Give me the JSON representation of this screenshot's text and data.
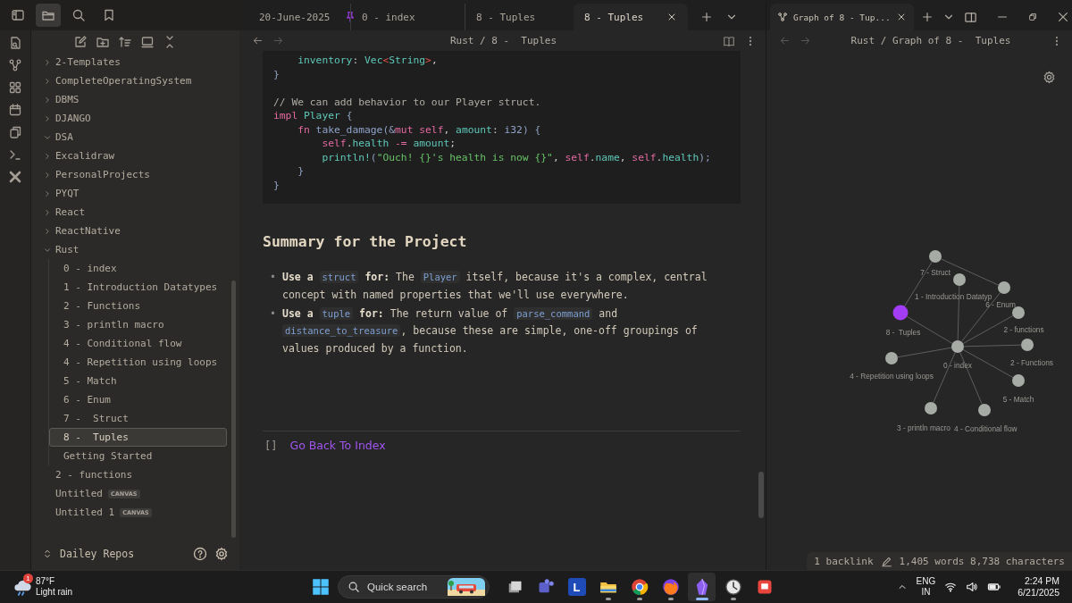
{
  "sidebar": {
    "tree": [
      {
        "label": "2-Templates",
        "kind": "folder",
        "expanded": false,
        "selected": false
      },
      {
        "label": "CompleteOperatingSystem",
        "kind": "folder",
        "expanded": false,
        "selected": false
      },
      {
        "label": "DBMS",
        "kind": "folder",
        "expanded": false,
        "selected": false
      },
      {
        "label": "DJANGO",
        "kind": "folder",
        "expanded": false,
        "selected": false
      },
      {
        "label": "DSA",
        "kind": "folder",
        "expanded": true,
        "selected": false
      },
      {
        "label": "Excalidraw",
        "kind": "folder",
        "expanded": false,
        "selected": false
      },
      {
        "label": "PersonalProjects",
        "kind": "folder",
        "expanded": false,
        "selected": false
      },
      {
        "label": "PYQT",
        "kind": "folder",
        "expanded": false,
        "selected": false
      },
      {
        "label": "React",
        "kind": "folder",
        "expanded": false,
        "selected": false
      },
      {
        "label": "ReactNative",
        "kind": "folder",
        "expanded": false,
        "selected": false
      },
      {
        "label": "Rust",
        "kind": "folder",
        "expanded": true,
        "selected": false,
        "children": [
          {
            "label": "0 - index",
            "kind": "file",
            "selected": false
          },
          {
            "label": "1 - Introduction Datatypes",
            "kind": "file",
            "selected": false
          },
          {
            "label": "2 - Functions",
            "kind": "file",
            "selected": false
          },
          {
            "label": "3 - println macro",
            "kind": "file",
            "selected": false
          },
          {
            "label": "4 - Conditional flow",
            "kind": "file",
            "selected": false
          },
          {
            "label": "4 - Repetition using loops",
            "kind": "file",
            "selected": false
          },
          {
            "label": "5 - Match",
            "kind": "file",
            "selected": false
          },
          {
            "label": "6 - Enum",
            "kind": "file",
            "selected": false
          },
          {
            "label": "7 -  Struct",
            "kind": "file",
            "selected": false
          },
          {
            "label": "8 -  Tuples",
            "kind": "file",
            "selected": true
          },
          {
            "label": "Getting Started",
            "kind": "file",
            "selected": false
          }
        ]
      },
      {
        "label": "2 - functions",
        "kind": "file",
        "selected": false
      },
      {
        "label": "Untitled",
        "kind": "file",
        "selected": false,
        "badge": "CANVAS"
      },
      {
        "label": "Untitled 1",
        "kind": "file",
        "selected": false,
        "badge": "CANVAS"
      }
    ],
    "vault": "Dailey Repos"
  },
  "editor": {
    "tabs": [
      {
        "label": "20-June-2025",
        "selected": false,
        "pinned": true
      },
      {
        "label": "0 - index",
        "selected": false,
        "pinned": false
      },
      {
        "label": "8 - Tuples",
        "selected": false,
        "pinned": false
      },
      {
        "label": "8 - Tuples",
        "selected": true,
        "pinned": false
      }
    ],
    "breadcrumb": "Rust / 8 -  Tuples",
    "code": [
      {
        "kind": "code",
        "tokens": [
          {
            "text": "    inventory",
            "kind": "field"
          },
          {
            "text": ": ",
            "kind": "plain"
          },
          {
            "text": "Vec",
            "kind": "type"
          },
          {
            "text": "<",
            "kind": "op"
          },
          {
            "text": "String",
            "kind": "type"
          },
          {
            "text": ">",
            "kind": "op"
          },
          {
            "text": ",",
            "kind": "plain"
          }
        ]
      },
      {
        "kind": "code",
        "tokens": [
          {
            "text": "}",
            "kind": "brace"
          }
        ]
      },
      {
        "kind": "blank"
      },
      {
        "kind": "code",
        "tokens": [
          {
            "text": "// We can add behavior to our Player struct.",
            "kind": "comment"
          }
        ]
      },
      {
        "kind": "code",
        "tokens": [
          {
            "text": "impl ",
            "kind": "keyword"
          },
          {
            "text": "Player",
            "kind": "type"
          },
          {
            "text": " {",
            "kind": "brace"
          }
        ]
      },
      {
        "kind": "code",
        "tokens": [
          {
            "text": "    fn ",
            "kind": "keyword"
          },
          {
            "text": "take_damage",
            "kind": "func"
          },
          {
            "text": "(&",
            "kind": "brace"
          },
          {
            "text": "mut ",
            "kind": "keyword"
          },
          {
            "text": "self",
            "kind": "keyword"
          },
          {
            "text": ", ",
            "kind": "plain"
          },
          {
            "text": "amount",
            "kind": "field"
          },
          {
            "text": ": ",
            "kind": "plain"
          },
          {
            "text": "i32",
            "kind": "func"
          },
          {
            "text": ") {",
            "kind": "brace"
          }
        ]
      },
      {
        "kind": "code",
        "tokens": [
          {
            "text": "        self",
            "kind": "keyword"
          },
          {
            "text": ".",
            "kind": "plain"
          },
          {
            "text": "health",
            "kind": "field"
          },
          {
            "text": " -= ",
            "kind": "keyword"
          },
          {
            "text": "amount",
            "kind": "field"
          },
          {
            "text": ";",
            "kind": "plain"
          }
        ]
      },
      {
        "kind": "code",
        "tokens": [
          {
            "text": "        println!",
            "kind": "field"
          },
          {
            "text": "(",
            "kind": "brace"
          },
          {
            "text": "\"Ouch! {}'s health is now {}\"",
            "kind": "string"
          },
          {
            "text": ", ",
            "kind": "plain"
          },
          {
            "text": "self",
            "kind": "keyword"
          },
          {
            "text": ".",
            "kind": "plain"
          },
          {
            "text": "name",
            "kind": "field"
          },
          {
            "text": ", ",
            "kind": "plain"
          },
          {
            "text": "self",
            "kind": "keyword"
          },
          {
            "text": ".",
            "kind": "plain"
          },
          {
            "text": "health",
            "kind": "field"
          },
          {
            "text": ");",
            "kind": "brace"
          }
        ]
      },
      {
        "kind": "code",
        "tokens": [
          {
            "text": "    }",
            "kind": "brace"
          }
        ]
      },
      {
        "kind": "code",
        "tokens": [
          {
            "text": "}",
            "kind": "brace"
          }
        ]
      }
    ],
    "heading": "Summary for the Project",
    "bullets": [
      {
        "marker": "•",
        "parts": [
          {
            "text": "Use a ",
            "kind": "bold"
          },
          {
            "text": "struct",
            "kind": "code"
          },
          {
            "text": " for:",
            "kind": "bold"
          },
          {
            "text": " The ",
            "kind": "text"
          },
          {
            "text": "Player",
            "kind": "code"
          },
          {
            "text": " itself, because it's a complex, central concept with named properties that we'll use everywhere.",
            "kind": "text"
          }
        ]
      },
      {
        "marker": "•",
        "parts": [
          {
            "text": "Use a ",
            "kind": "bold"
          },
          {
            "text": "tuple",
            "kind": "code"
          },
          {
            "text": " for:",
            "kind": "bold"
          },
          {
            "text": " The return value of ",
            "kind": "text"
          },
          {
            "text": "parse_command",
            "kind": "code"
          },
          {
            "text": " and ",
            "kind": "text"
          },
          {
            "text": "distance_to_treasure",
            "kind": "code"
          },
          {
            "text": ", because these are simple, one-off groupings of values produced by a function.",
            "kind": "text"
          }
        ]
      }
    ],
    "brackets": "[]",
    "link": "Go Back To Index"
  },
  "graph": {
    "tab": "Graph of 8 - Tup...",
    "breadcrumb": "Rust / Graph of 8 -  Tuples",
    "nodes": [
      {
        "label": "7 - Struct",
        "selected": false
      },
      {
        "label": "1 - Introduction Datatyp",
        "selected": false
      },
      {
        "label": "6 - Enum",
        "selected": false
      },
      {
        "label": "8 -  Tuples",
        "selected": true
      },
      {
        "label": "2 - functions",
        "selected": false
      },
      {
        "label": "0 - index",
        "selected": false
      },
      {
        "label": "2 - Functions",
        "selected": false
      },
      {
        "label": "4 - Repetition using loops",
        "selected": false
      },
      {
        "label": "5 - Match",
        "selected": false
      },
      {
        "label": "3 - println macro",
        "selected": false
      },
      {
        "label": "4 - Conditional flow",
        "selected": false
      }
    ]
  },
  "status_bar": {
    "backlinks": "1 backlink",
    "counts": "1,405 words 8,738 characters"
  },
  "taskbar": {
    "weather_badge": "1",
    "temperature": "87°F",
    "weather": "Light rain",
    "search": "Quick search",
    "apps": [
      {
        "kind": "taskview",
        "running": false,
        "selected": false
      },
      {
        "kind": "chat",
        "running": false,
        "selected": false
      },
      {
        "kind": "letter",
        "letter": "L",
        "running": false,
        "selected": false
      },
      {
        "kind": "folder",
        "running": true,
        "selected": false
      },
      {
        "kind": "chrome",
        "running": true,
        "selected": false
      },
      {
        "kind": "fox",
        "running": true,
        "selected": false
      },
      {
        "kind": "gem",
        "running": true,
        "selected": true
      },
      {
        "kind": "clock",
        "running": true,
        "selected": false
      },
      {
        "kind": "square",
        "running": false,
        "selected": false
      }
    ],
    "language": "ENG",
    "region": "IN",
    "time": "2:24 PM",
    "date": "6/21/2025"
  }
}
